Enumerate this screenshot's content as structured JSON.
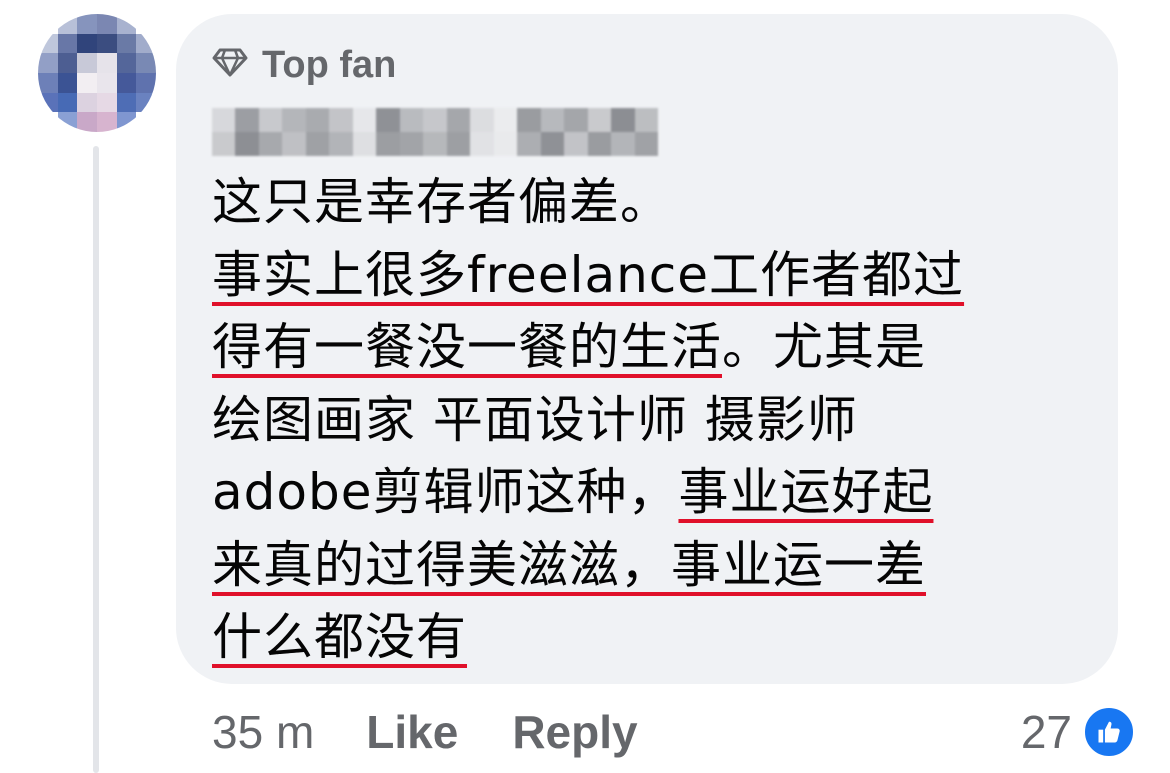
{
  "comment": {
    "badge": "Top fan",
    "badge_icon": "diamond-icon",
    "lines": [
      {
        "plain1": "这只是幸存者偏差。",
        "underlined": "",
        "plain2": ""
      },
      {
        "plain1": "",
        "underlined": "事实上很多freelance工作者都过",
        "plain2": ""
      },
      {
        "plain1": "",
        "underlined": "得有一餐没一餐的生活",
        "plain2": "。尤其是"
      },
      {
        "plain1": "绘图画家 平面设计师 摄影师",
        "underlined": "",
        "plain2": ""
      },
      {
        "plain1": "adobe剪辑师这种，",
        "underlined": "事业运好起",
        "plain2": ""
      },
      {
        "plain1": "",
        "underlined": "来真的过得美滋滋，事业运一差",
        "plain2": ""
      },
      {
        "plain1": "",
        "underlined": "什么都没有",
        "plain2": ""
      }
    ],
    "underline_color": "#e0102a"
  },
  "footer": {
    "time": "35 m",
    "like_label": "Like",
    "reply_label": "Reply",
    "reaction_count": "27",
    "reaction_icon": "thumbs-up-icon"
  },
  "colors": {
    "bubble": "#f0f2f5",
    "muted_text": "#65676b",
    "body_text": "#050505",
    "like_blue": "#1877f2"
  }
}
